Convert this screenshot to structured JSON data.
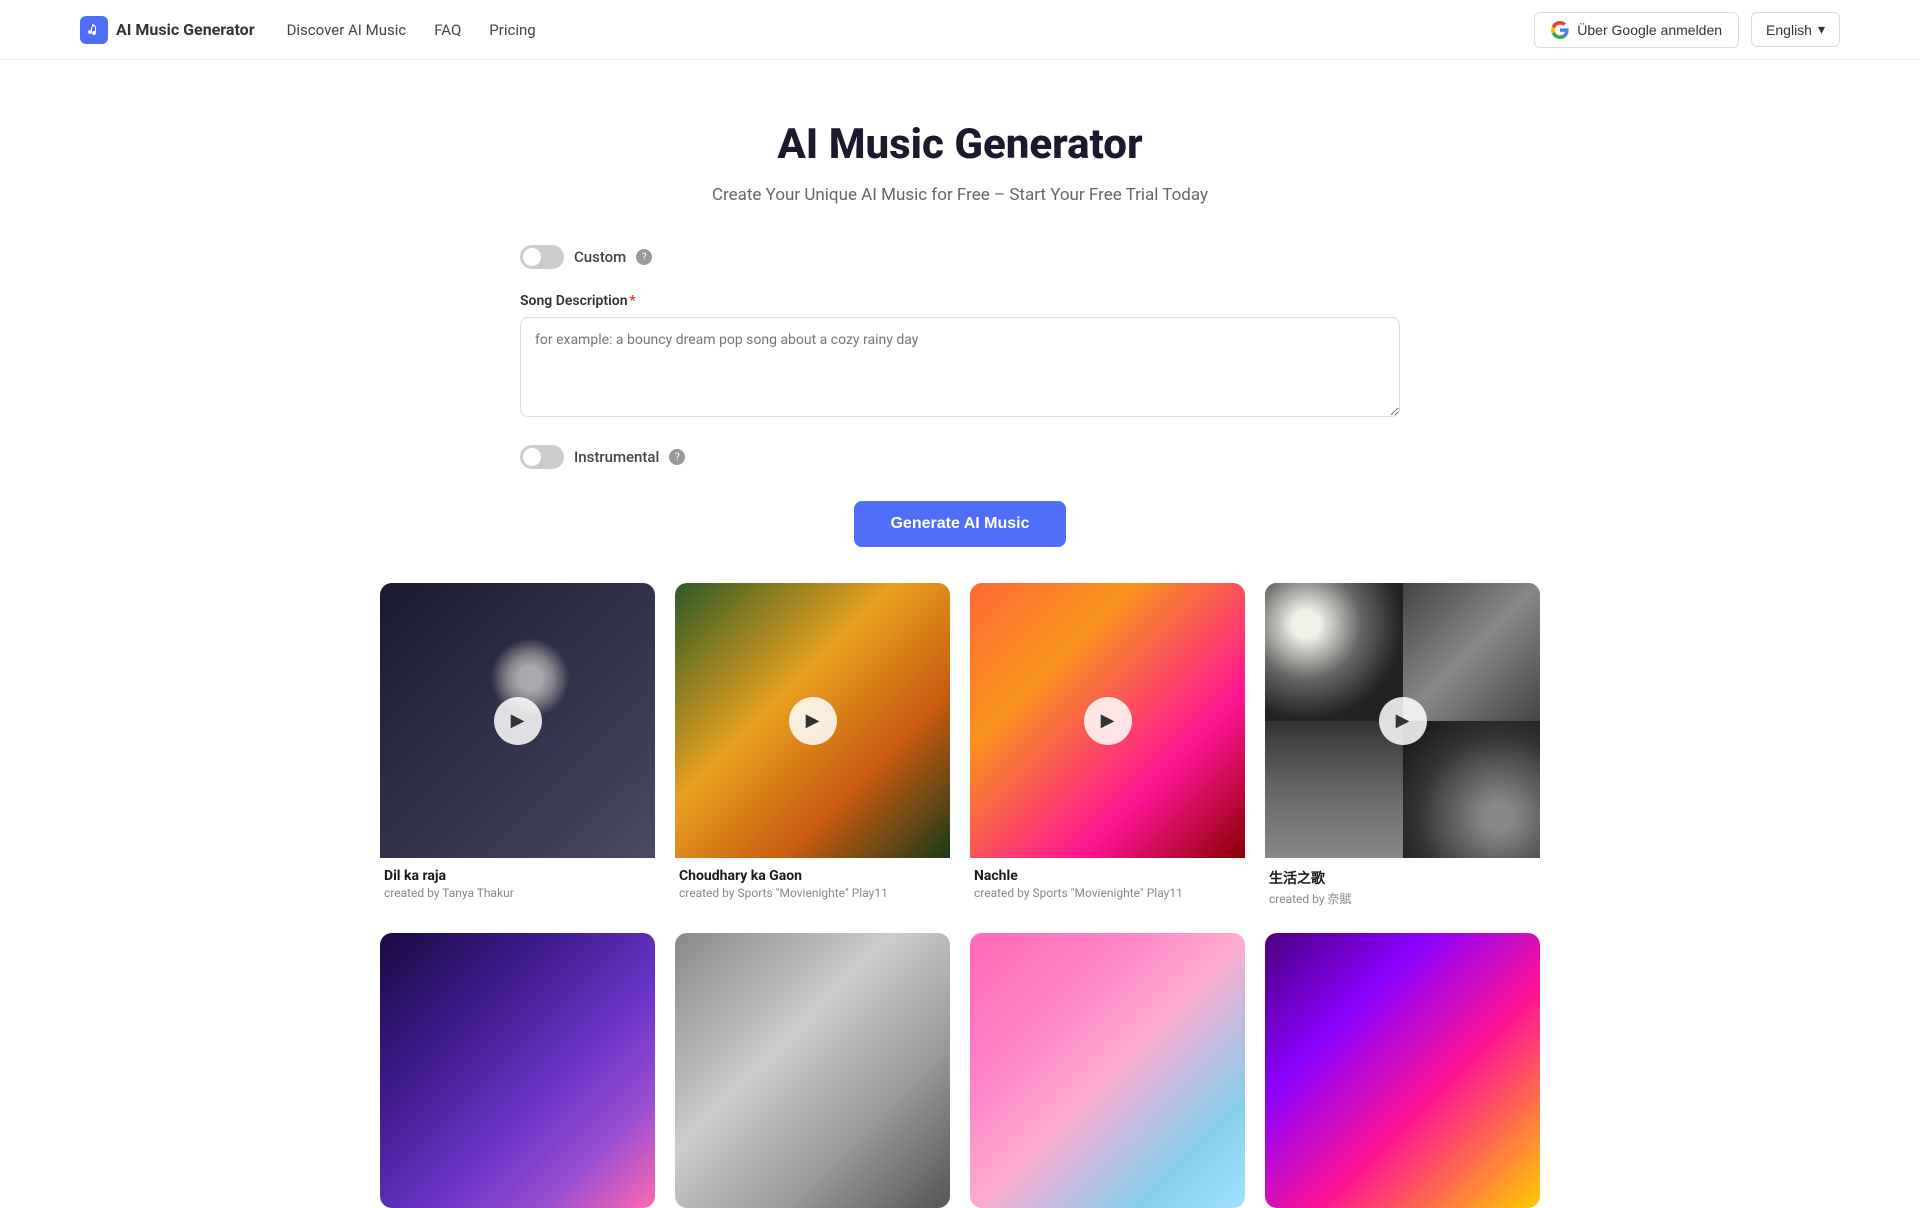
{
  "navbar": {
    "logo_icon": "♪",
    "logo_text": "AI Music Generator",
    "links": [
      {
        "label": "Discover AI Music",
        "href": "#"
      },
      {
        "label": "FAQ",
        "href": "#"
      },
      {
        "label": "Pricing",
        "href": "#"
      }
    ],
    "google_login": "Über Google anmelden",
    "language": "English",
    "language_chevron": "▾"
  },
  "hero": {
    "title": "AI Music Generator",
    "subtitle": "Create Your Unique AI Music for Free – Start Your Free Trial Today"
  },
  "form": {
    "custom_label": "Custom",
    "custom_info": "?",
    "song_description_label": "Song Description",
    "song_description_required": "*",
    "song_description_placeholder": "for example: a bouncy dream pop song about a cozy rainy day",
    "instrumental_label": "Instrumental",
    "instrumental_info": "?",
    "generate_button": "Generate AI Music"
  },
  "music_cards": [
    {
      "title": "Dil ka raja",
      "creator": "created by Tanya Thakur",
      "img_class": "card-img-1"
    },
    {
      "title": "Choudhary ka Gaon",
      "creator": "created by Sports \"Movienighte\" Play11",
      "img_class": "card-img-2"
    },
    {
      "title": "Nachle",
      "creator": "created by Sports \"Movienighte\" Play11",
      "img_class": "card-img-3"
    },
    {
      "title": "生活之歌",
      "creator": "created by 奈賦",
      "img_class": "card-img-4"
    },
    {
      "title": "",
      "creator": "",
      "img_class": "card-img-5"
    },
    {
      "title": "",
      "creator": "",
      "img_class": "card-img-6"
    },
    {
      "title": "",
      "creator": "",
      "img_class": "card-img-7"
    },
    {
      "title": "",
      "creator": "",
      "img_class": "card-img-8"
    }
  ]
}
